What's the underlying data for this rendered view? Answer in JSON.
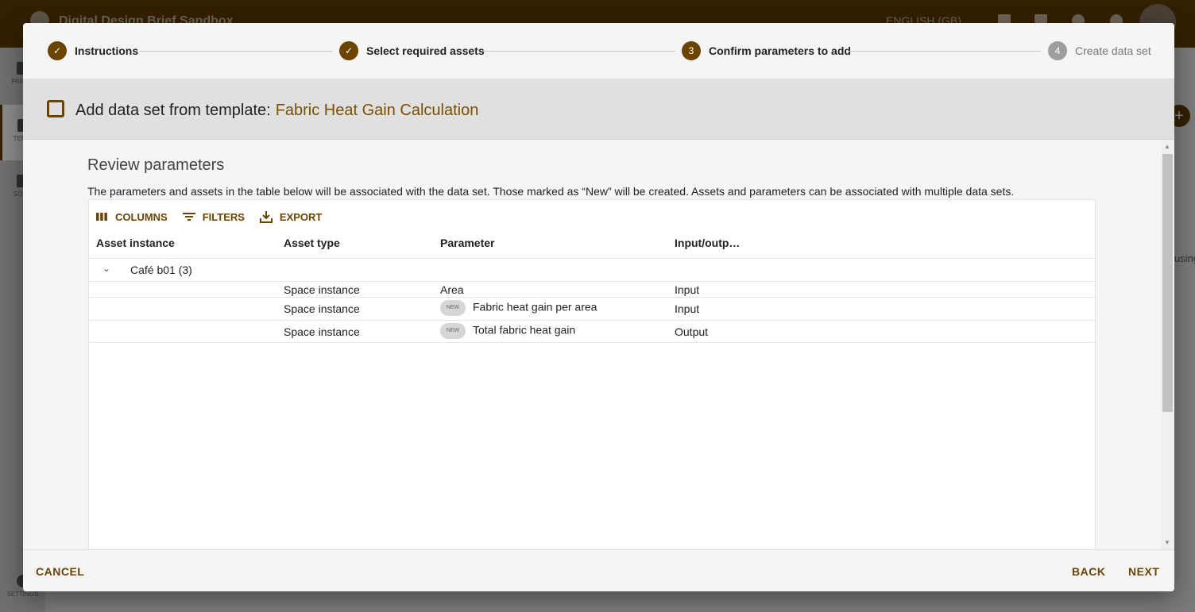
{
  "app": {
    "title": "Digital Design Brief Sandbox",
    "language": "ENGLISH (GB)"
  },
  "sidebar": {
    "items": [
      {
        "label": "PARAM"
      },
      {
        "label": "TEMPL"
      },
      {
        "label": "SOUR"
      },
      {
        "label": "SETTINGS"
      }
    ]
  },
  "background": {
    "right_text": "using"
  },
  "stepper": {
    "steps": [
      {
        "label": "Instructions",
        "state": "done"
      },
      {
        "label": "Select required assets",
        "state": "done"
      },
      {
        "label": "Confirm parameters to add",
        "number": "3",
        "state": "active"
      },
      {
        "label": "Create data set",
        "number": "4",
        "state": "pending"
      }
    ]
  },
  "dialog": {
    "title_prefix": "Add data set from template:",
    "template_name": "Fabric Heat Gain Calculation",
    "section_title": "Review parameters",
    "description": "The parameters and assets in the table below will be associated with the data set. Those marked as “New” will be created. Assets and parameters can be associated with multiple data sets."
  },
  "toolbar": {
    "columns": "COLUMNS",
    "filters": "FILTERS",
    "export": "EXPORT"
  },
  "table": {
    "headers": [
      "Asset instance",
      "Asset type",
      "Parameter",
      "Input/outp…"
    ],
    "group": "Café b01 (3)",
    "new_badge": "NEW",
    "rows": [
      {
        "asset_type": "Space instance",
        "parameter": "Area",
        "is_new": false,
        "io": "Input"
      },
      {
        "asset_type": "Space instance",
        "parameter": "Fabric heat gain per area",
        "is_new": true,
        "io": "Input"
      },
      {
        "asset_type": "Space instance",
        "parameter": "Total fabric heat gain",
        "is_new": true,
        "io": "Output"
      }
    ]
  },
  "footer": {
    "cancel": "CANCEL",
    "back": "BACK",
    "next": "NEXT"
  },
  "colors": {
    "accent": "#6b4400",
    "appbar": "#332000"
  }
}
